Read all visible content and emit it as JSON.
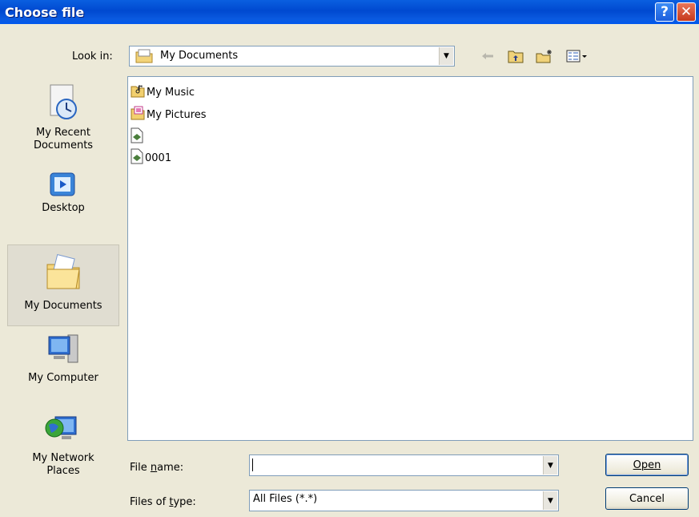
{
  "window": {
    "title": "Choose file",
    "help_glyph": "?",
    "close_glyph": "✕"
  },
  "lookin": {
    "label": "Look in:",
    "value": "My Documents",
    "icon": "folder-icon"
  },
  "toolbar": {
    "icons": [
      "back-arrow-icon",
      "up-folder-icon",
      "new-folder-icon",
      "view-menu-icon"
    ]
  },
  "places": [
    {
      "label": "My Recent Documents",
      "line1": "My Recent",
      "line2": "Documents",
      "icon": "recent-documents-icon"
    },
    {
      "label": "Desktop",
      "icon": "desktop-icon"
    },
    {
      "label": "My Documents",
      "icon": "my-documents-folder-icon",
      "selected": true
    },
    {
      "label": "My Computer",
      "icon": "computer-icon"
    },
    {
      "label": "My Network Places",
      "line1": "My Network",
      "line2": "Places",
      "icon": "network-icon"
    }
  ],
  "files": [
    {
      "name": "My Music",
      "icon": "music-folder-icon"
    },
    {
      "name": "My Pictures",
      "icon": "pictures-folder-icon"
    },
    {
      "name": "",
      "icon": "file-icon"
    },
    {
      "name": "0001",
      "icon": "file-icon"
    }
  ],
  "filename": {
    "label": "File name:",
    "value": ""
  },
  "filetype": {
    "label": "Files of type:",
    "value": "All Files (*.*)"
  },
  "buttons": {
    "open": "Open",
    "cancel": "Cancel"
  },
  "colors": {
    "titlebar": "#0a5fe0",
    "face": "#ece9d8",
    "border": "#7f9db9"
  }
}
